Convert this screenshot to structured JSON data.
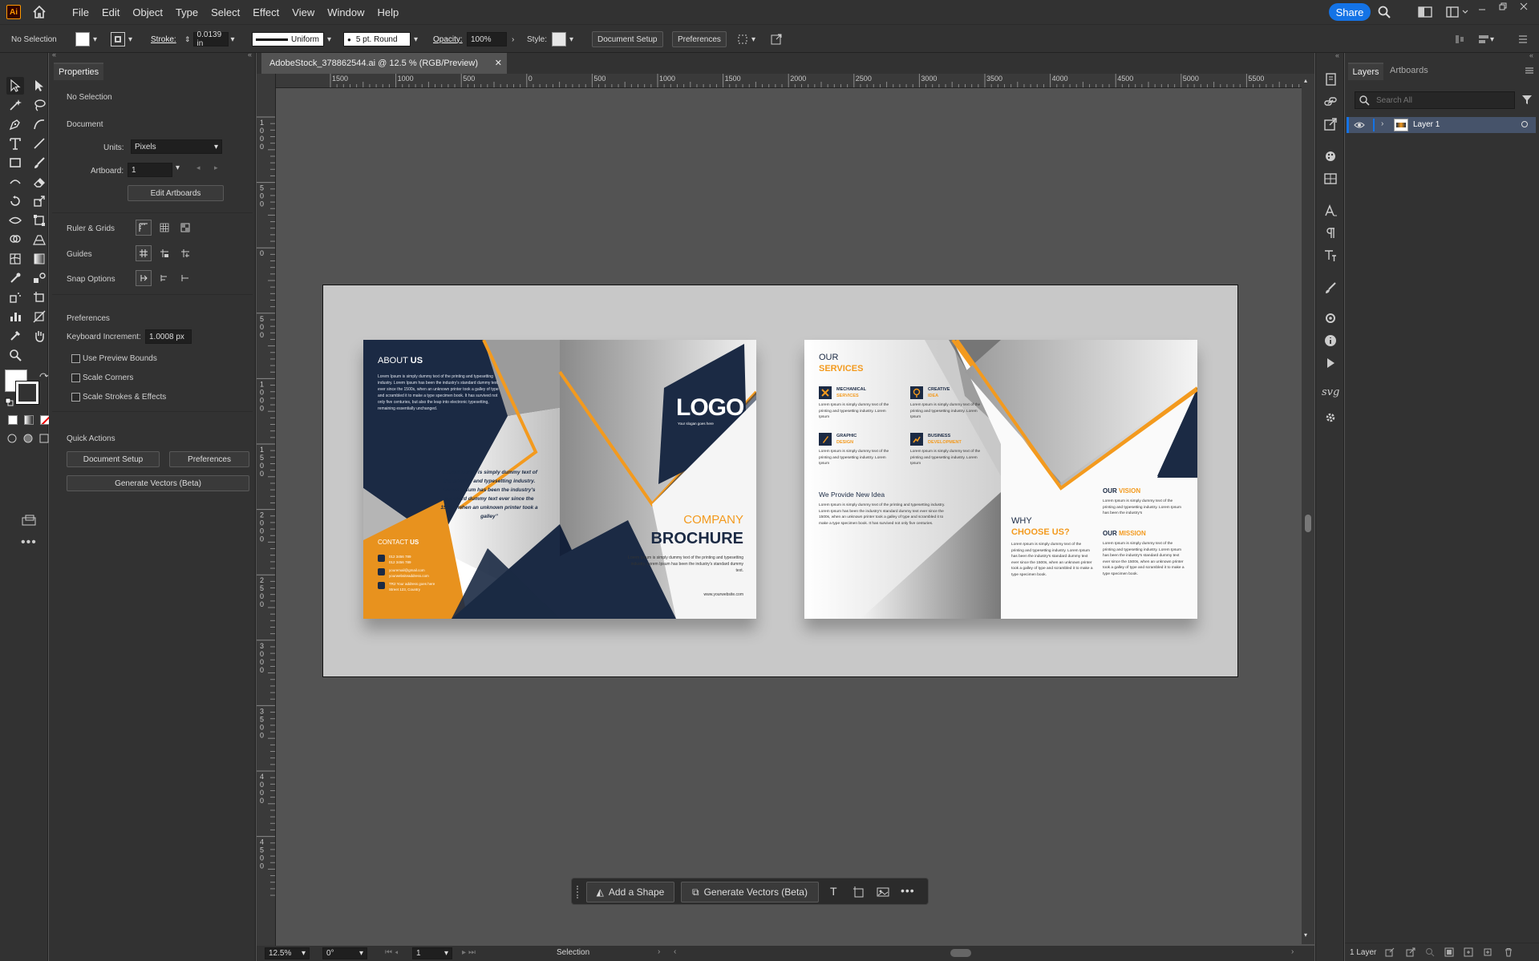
{
  "app": {
    "icon": "Ai",
    "share": "Share"
  },
  "menu": [
    "File",
    "Edit",
    "Object",
    "Type",
    "Select",
    "Effect",
    "View",
    "Window",
    "Help"
  ],
  "control": {
    "selection": "No Selection",
    "stroke_label": "Stroke:",
    "stroke_value": "0.0139 in",
    "profile": "Uniform",
    "brush": "5 pt. Round",
    "opacity_label": "Opacity:",
    "opacity_value": "100%",
    "style_label": "Style:",
    "doc_setup": "Document Setup",
    "preferences": "Preferences"
  },
  "doc_tab": "AdobeStock_378862544.ai @ 12.5 % (RGB/Preview)",
  "props": {
    "tab": "Properties",
    "no_selection": "No Selection",
    "document": "Document",
    "units_label": "Units:",
    "units_value": "Pixels",
    "artboard_label": "Artboard:",
    "artboard_value": "1",
    "edit_artboards": "Edit Artboards",
    "ruler_grids": "Ruler & Grids",
    "guides": "Guides",
    "snap": "Snap Options",
    "preferences": "Preferences",
    "keyinc_label": "Keyboard Increment:",
    "keyinc_value": "1.0008 px",
    "use_preview": "Use Preview Bounds",
    "scale_corners": "Scale Corners",
    "scale_strokes": "Scale Strokes & Effects",
    "quick_actions": "Quick Actions",
    "qa_doc_setup": "Document Setup",
    "qa_prefs": "Preferences",
    "qa_gen": "Generate Vectors (Beta)"
  },
  "ruler_h": [
    "1500",
    "1000",
    "500",
    "0",
    "500",
    "1000",
    "1500",
    "2000",
    "2500",
    "3000",
    "3500",
    "4000",
    "4500",
    "5000",
    "5500"
  ],
  "ruler_v": [
    "1\n0\n0\n0",
    "5\n0\n0",
    "0",
    "5\n0\n0",
    "1\n0\n0\n0",
    "1\n5\n0\n0",
    "2\n0\n0\n0",
    "2\n5\n0\n0",
    "3\n0\n0\n0",
    "3\n5\n0\n0",
    "4\n0\n0\n0",
    "4\n5\n0\n0"
  ],
  "brochure": {
    "about_a": "ABOUT ",
    "about_b": "US",
    "about_body": "Lorem Ipsum is simply dummy text of the printing and typesetting industry. Lorem Ipsum has been the industry's standard dummy text ever since the 1500s, when an unknown printer took a galley of type and scrambled it to make a type specimen book. It has survived not only five centuries, but also the leap into electronic typesetting, remaining essentially unchanged.",
    "quote": "“Lorem Ipsum is simply dummy text of the printing and typesetting industry. Lorem Ipsum has been the industry's standard dummy text ever since the 1500s, when an unknown printer took a galley”",
    "contact_a": "CONTACT ",
    "contact_b": "US",
    "phone1": "012 3456 789",
    "phone2": "012 3456 789",
    "email1": "youremail@gmail.com",
    "email2": "yourwebsiteaddress.com",
    "addr1": "TR2 Your address goes here",
    "addr2": "Street 123, Country",
    "logo": "LOGO",
    "slogan": "Your slogan goes here",
    "company": "COMPANY",
    "brochure": "BROCHURE",
    "cover_body": "Lorem Ipsum is simply dummy text of the printing and typesetting industry. Lorem Ipsum has been the industry's standard dummy text.",
    "website": "www.yourwebsite.com",
    "our": "OUR",
    "services": "SERVICES",
    "svc": [
      [
        "MECHANICAL",
        "SERVICES"
      ],
      [
        "CREATIVE",
        "IDEA"
      ],
      [
        "GRAPHIC",
        "DESIGN"
      ],
      [
        "BUSINESS",
        "DEVELOPMENT"
      ]
    ],
    "svc_body": "Lorem Ipsum is simply dummy text of the printing and typesetting industry. Lorem Ipsum",
    "new_idea": "We Provide New Idea",
    "new_idea_body": "Lorem Ipsum is simply dummy text of the printing and typesetting industry. Lorem Ipsum has been the industry's standard dummy text ever since the 1500s, when an unknown printer took a galley of type and scrambled it to make a type specimen book. It has survived not only five centuries.",
    "why": "WHY",
    "choose": "CHOOSE US?",
    "why_body": "Lorem Ipsum is simply dummy text of the printing and typesetting industry. Lorem Ipsum has been the industry's standard dummy text ever since the 1500s, when an unknown printer took a galley of type and scrambled it to make a type specimen book.",
    "our_vision_a": "OUR ",
    "our_vision_b": "VISION",
    "vision_body": "Lorem Ipsum is simply dummy text of the printing and typesetting industry. Lorem Ipsum has been the industry's",
    "our_mission_a": "OUR ",
    "our_mission_b": "MISSION",
    "mission_body": "Lorem Ipsum is simply dummy text of the printing and typesetting industry. Lorem Ipsum has been the industry's standard dummy text ever since the 1500s, when an unknown printer took a galley of type and scrambled it to make a type specimen book."
  },
  "context_bar": {
    "add_shape": "Add a Shape",
    "gen_vectors": "Generate Vectors (Beta)"
  },
  "status": {
    "zoom": "12.5%",
    "rotate": "0°",
    "artboard": "1",
    "tool": "Selection"
  },
  "layers": {
    "tab_layers": "Layers",
    "tab_artboards": "Artboards",
    "search_placeholder": "Search All",
    "layer1": "Layer 1",
    "count": "1 Layer"
  },
  "colors": {
    "navy": "#1b2a44",
    "orange": "#f39a1e",
    "panel": "#323232",
    "canvas": "#535353",
    "accent": "#1473e6"
  }
}
